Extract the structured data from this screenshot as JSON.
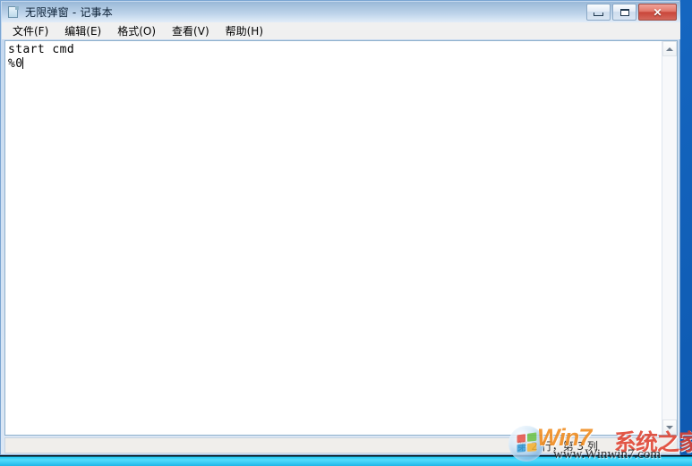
{
  "window": {
    "title": "无限弹窗 - 记事本",
    "icon": "notepad-document-icon",
    "caption_buttons": {
      "minimize_label": "最小化",
      "maximize_label": "最大化",
      "close_label": "✕"
    }
  },
  "menubar": {
    "items": [
      {
        "label": "文件(F)"
      },
      {
        "label": "编辑(E)"
      },
      {
        "label": "格式(O)"
      },
      {
        "label": "查看(V)"
      },
      {
        "label": "帮助(H)"
      }
    ]
  },
  "editor": {
    "lines": [
      "start cmd",
      "%0"
    ]
  },
  "scrollbar": {
    "up_arrow": "scroll-up-arrow",
    "down_arrow": "scroll-down-arrow"
  },
  "statusbar": {
    "position_text": "第 2 行，第 3 列"
  },
  "watermark": {
    "brand_latin": "Win7",
    "brand_cn": "系统之家",
    "url": "www.Winwin7.com"
  },
  "colors": {
    "titlebar_top": "#99b8d8",
    "titlebar_bottom": "#e2ecf8",
    "close_button": "#c9463a",
    "desktop": "#1565c0",
    "taskbar": "#37c8f2",
    "editor_bg": "#ffffff",
    "statusbar_bg": "#f0eeeb",
    "watermark_orange": "#f08a1c",
    "watermark_red": "#e0412f"
  }
}
